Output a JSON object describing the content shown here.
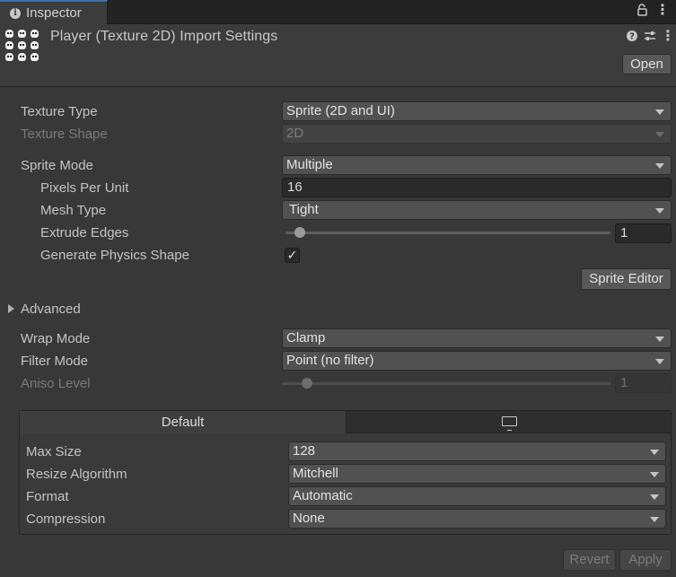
{
  "tab": {
    "label": "Inspector"
  },
  "tab_icons": {
    "lock": "lock-icon",
    "menu": "kebab-menu-icon"
  },
  "header": {
    "title": "Player (Texture 2D) Import Settings",
    "open_label": "Open",
    "icons": [
      "help-icon",
      "preset-icon",
      "kebab-menu-icon"
    ]
  },
  "fields": {
    "texture_type": {
      "label": "Texture Type",
      "value": "Sprite (2D and UI)"
    },
    "texture_shape": {
      "label": "Texture Shape",
      "value": "2D"
    },
    "sprite_mode": {
      "label": "Sprite Mode",
      "value": "Multiple"
    },
    "pixels_per_unit": {
      "label": "Pixels Per Unit",
      "value": "16"
    },
    "mesh_type": {
      "label": "Mesh Type",
      "value": "Tight"
    },
    "extrude_edges": {
      "label": "Extrude Edges",
      "value": "1",
      "slider_fraction": 0.0
    },
    "generate_physics_shape": {
      "label": "Generate Physics Shape",
      "checked": true,
      "check_glyph": "✓"
    },
    "sprite_editor_label": "Sprite Editor",
    "advanced_label": "Advanced",
    "wrap_mode": {
      "label": "Wrap Mode",
      "value": "Clamp"
    },
    "filter_mode": {
      "label": "Filter Mode",
      "value": "Point (no filter)"
    },
    "aniso_level": {
      "label": "Aniso Level",
      "value": "1",
      "slider_fraction": 0.0
    }
  },
  "platform": {
    "tabs": [
      {
        "label": "Default"
      },
      {
        "icon": "monitor-icon"
      }
    ],
    "max_size": {
      "label": "Max Size",
      "value": "128"
    },
    "resize_algorithm": {
      "label": "Resize Algorithm",
      "value": "Mitchell"
    },
    "format": {
      "label": "Format",
      "value": "Automatic"
    },
    "compression": {
      "label": "Compression",
      "value": "None"
    }
  },
  "footer": {
    "revert_label": "Revert",
    "apply_label": "Apply"
  },
  "colors": {
    "background": "#383838",
    "header": "#3c3c3c",
    "tab_accent": "#3a72b0"
  }
}
